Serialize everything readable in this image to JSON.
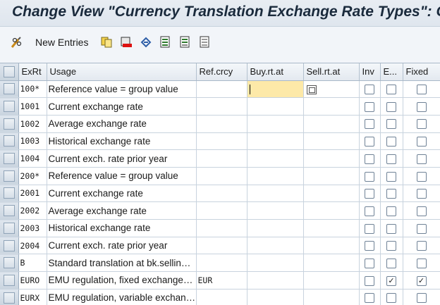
{
  "window": {
    "title": "Change View \"Currency Translation Exchange Rate Types\": C"
  },
  "toolbar": {
    "new_entries_label": "New Entries",
    "icons": [
      "glasses-pen-icon",
      "copy-icon",
      "delete-icon",
      "undo-icon",
      "select-all-icon",
      "select-block-icon",
      "deselect-all-icon"
    ]
  },
  "table": {
    "headers": {
      "exrt": "ExRt",
      "usage": "Usage",
      "refcrcy": "Ref.crcy",
      "buy": "Buy.rt.at",
      "sell": "Sell.rt.at",
      "inv": "Inv",
      "e": "E...",
      "fixed": "Fixed"
    },
    "rows": [
      {
        "exrt": "100*",
        "usage": "Reference value = group value",
        "refcrcy": "",
        "inv": false,
        "e": false,
        "fixed": false
      },
      {
        "exrt": "1001",
        "usage": "Current exchange rate",
        "refcrcy": "",
        "inv": false,
        "e": false,
        "fixed": false
      },
      {
        "exrt": "1002",
        "usage": "Average exchange rate",
        "refcrcy": "",
        "inv": false,
        "e": false,
        "fixed": false
      },
      {
        "exrt": "1003",
        "usage": "Historical exchange rate",
        "refcrcy": "",
        "inv": false,
        "e": false,
        "fixed": false
      },
      {
        "exrt": "1004",
        "usage": "Current exch. rate prior year",
        "refcrcy": "",
        "inv": false,
        "e": false,
        "fixed": false
      },
      {
        "exrt": "200*",
        "usage": "Reference value = group value",
        "refcrcy": "",
        "inv": false,
        "e": false,
        "fixed": false
      },
      {
        "exrt": "2001",
        "usage": "Current exchange rate",
        "refcrcy": "",
        "inv": false,
        "e": false,
        "fixed": false
      },
      {
        "exrt": "2002",
        "usage": "Average exchange rate",
        "refcrcy": "",
        "inv": false,
        "e": false,
        "fixed": false
      },
      {
        "exrt": "2003",
        "usage": "Historical exchange rate",
        "refcrcy": "",
        "inv": false,
        "e": false,
        "fixed": false
      },
      {
        "exrt": "2004",
        "usage": "Current exch. rate prior year",
        "refcrcy": "",
        "inv": false,
        "e": false,
        "fixed": false
      },
      {
        "exrt": "B",
        "usage": "Standard translation at bk.sellin…",
        "refcrcy": "",
        "inv": false,
        "e": false,
        "fixed": false
      },
      {
        "exrt": "EURO",
        "usage": "EMU regulation, fixed exchange…",
        "refcrcy": "EUR",
        "inv": false,
        "e": true,
        "fixed": true
      },
      {
        "exrt": "EURX",
        "usage": "EMU regulation, variable exchan…",
        "refcrcy": "",
        "inv": false,
        "e": false,
        "fixed": false
      }
    ]
  },
  "colors": {
    "active_cell": "#fde9a8",
    "title_text": "#1a2a3c"
  }
}
